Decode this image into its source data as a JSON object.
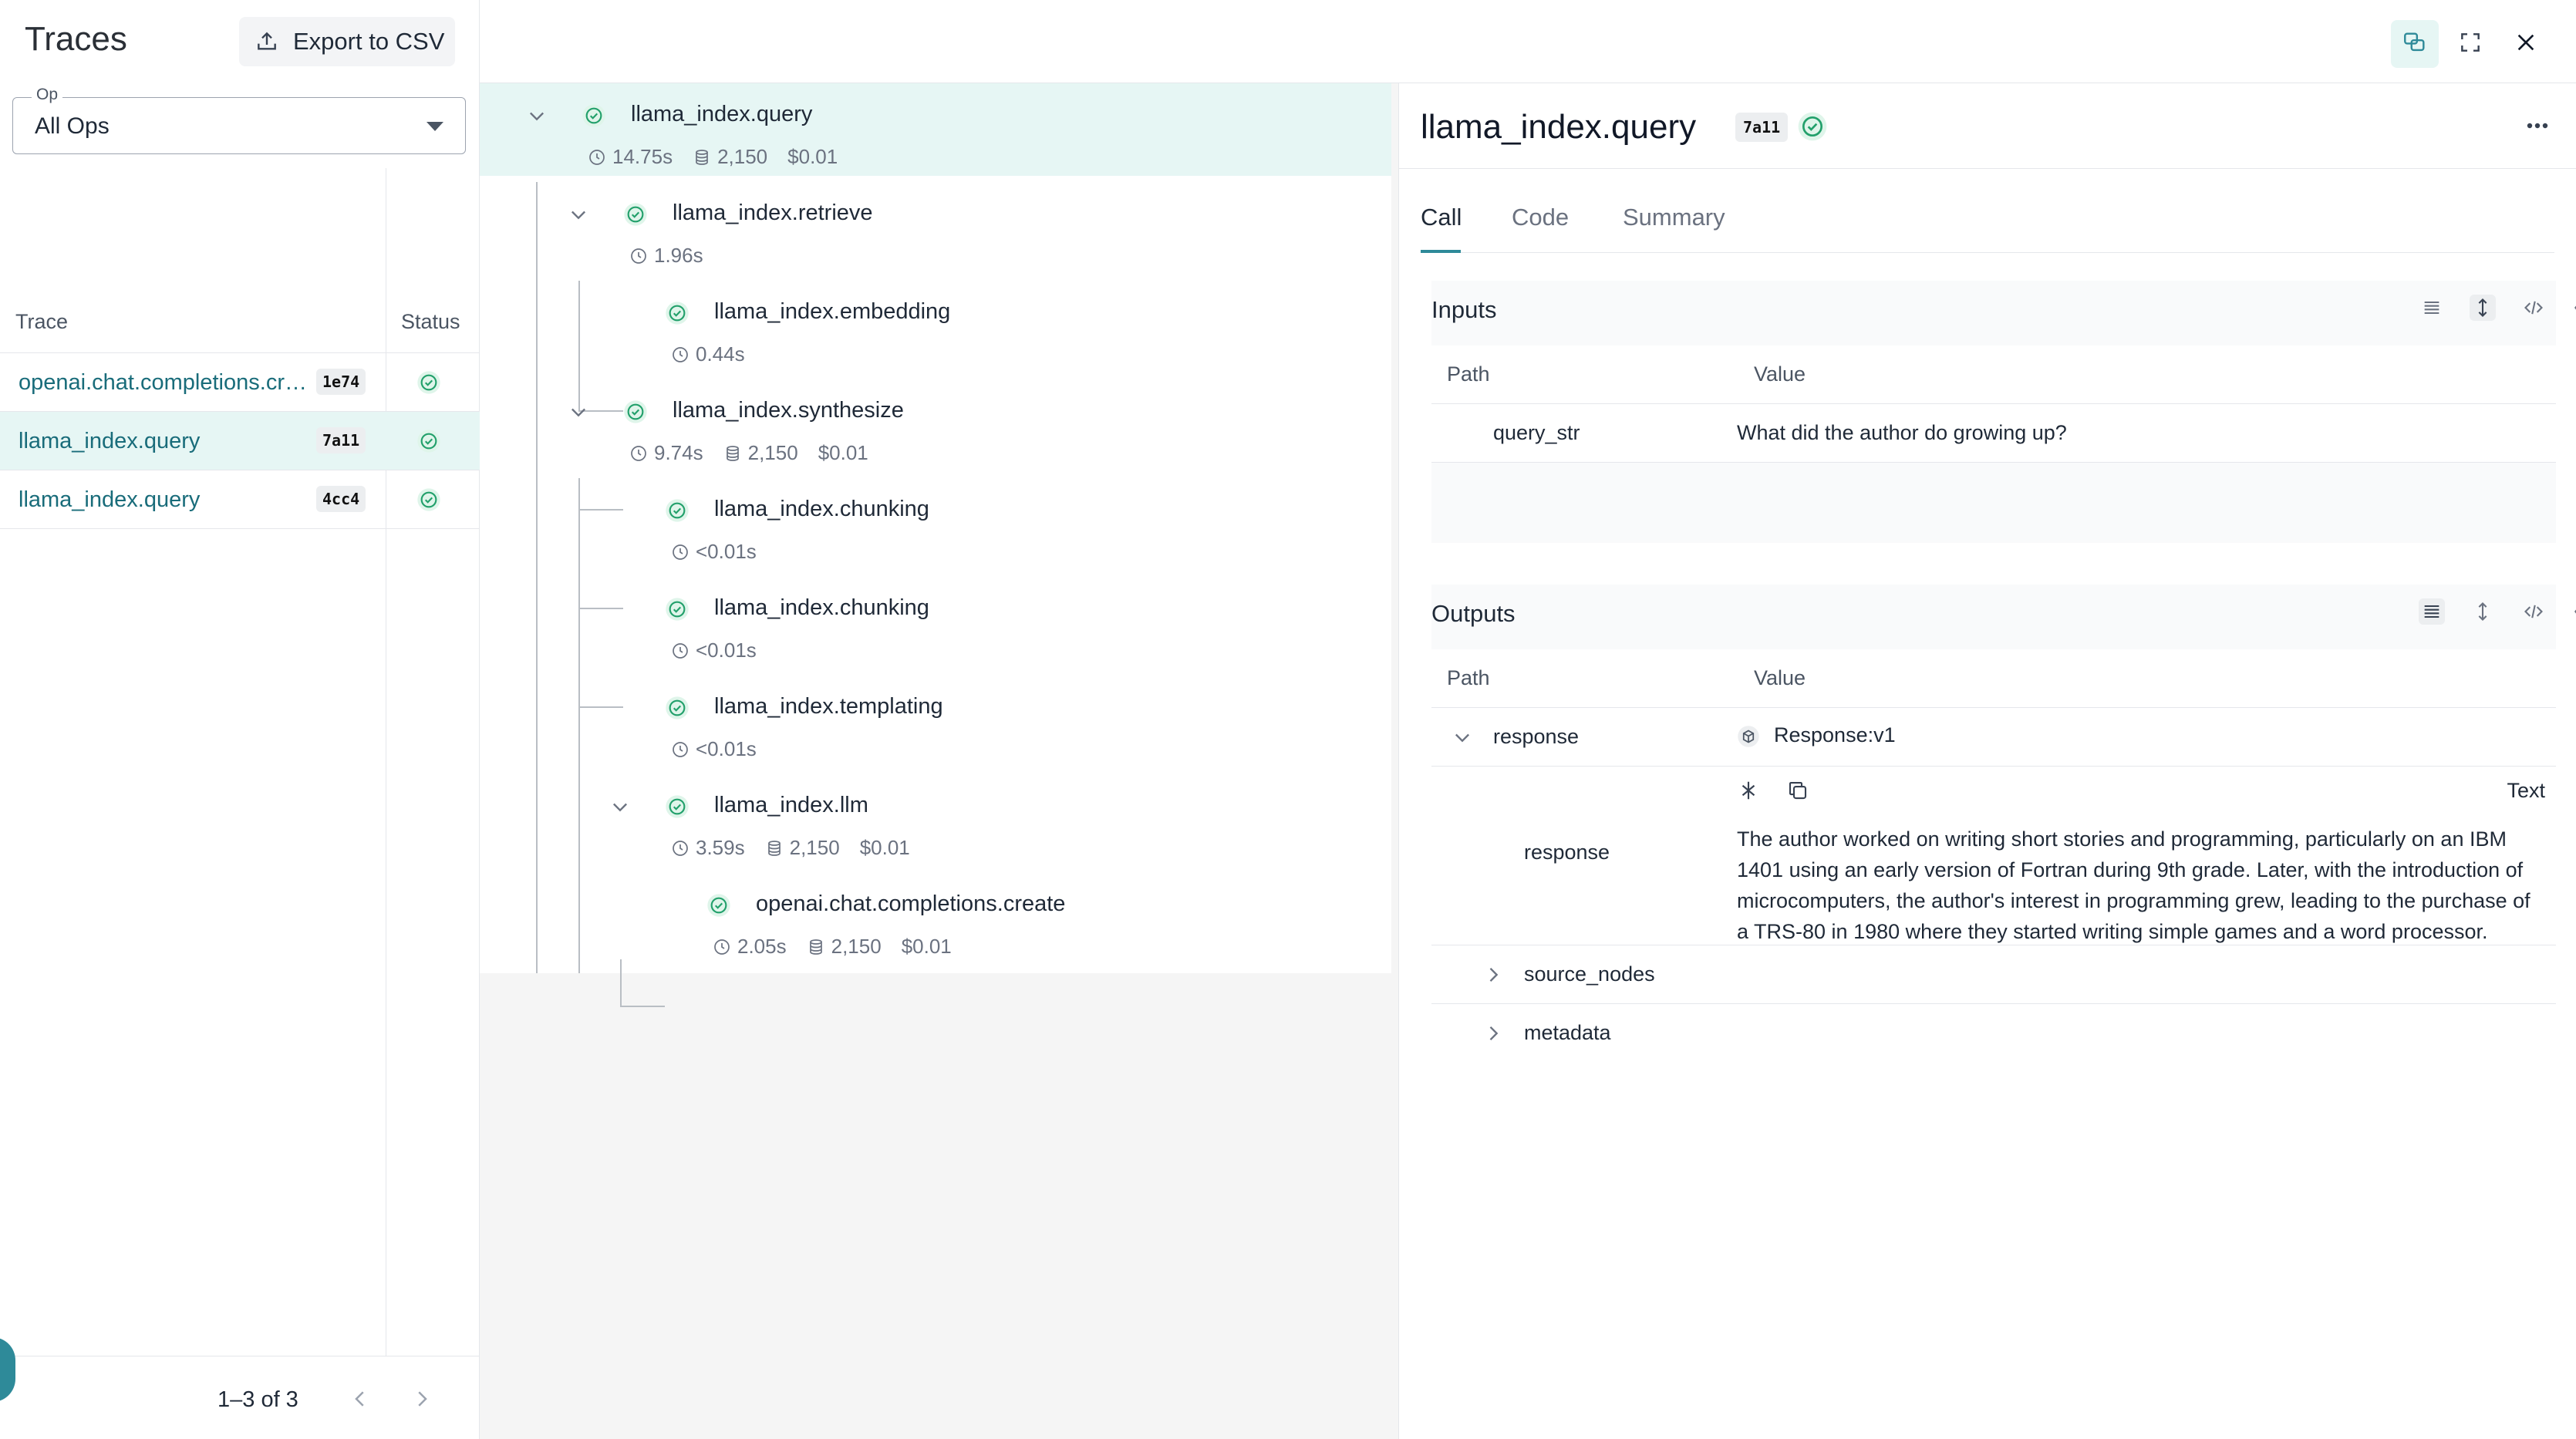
{
  "left_panel": {
    "title": "Traces",
    "export_label": "Export to CSV",
    "op_filter": {
      "label": "Op",
      "value": "All Ops"
    },
    "columns": {
      "trace": "Trace",
      "status": "Status"
    },
    "rows": [
      {
        "name": "openai.chat.completions.create",
        "id": "1e74",
        "status": "success"
      },
      {
        "name": "llama_index.query",
        "id": "7a11",
        "status": "success"
      },
      {
        "name": "llama_index.query",
        "id": "4cc4",
        "status": "success"
      }
    ],
    "pager": {
      "text": "1–3 of 3"
    }
  },
  "tree": {
    "nodes": [
      {
        "name": "llama_index.query",
        "time": "14.75s",
        "tokens": "2,150",
        "cost": "$0.01"
      },
      {
        "name": "llama_index.retrieve",
        "time": "1.96s"
      },
      {
        "name": "llama_index.embedding",
        "time": "0.44s"
      },
      {
        "name": "llama_index.synthesize",
        "time": "9.74s",
        "tokens": "2,150",
        "cost": "$0.01"
      },
      {
        "name": "llama_index.chunking",
        "time": "<0.01s"
      },
      {
        "name": "llama_index.chunking",
        "time": "<0.01s"
      },
      {
        "name": "llama_index.templating",
        "time": "<0.01s"
      },
      {
        "name": "llama_index.llm",
        "time": "3.59s",
        "tokens": "2,150",
        "cost": "$0.01"
      },
      {
        "name": "openai.chat.completions.create",
        "time": "2.05s",
        "tokens": "2,150",
        "cost": "$0.01"
      }
    ]
  },
  "details": {
    "title": "llama_index.query",
    "id": "7a11",
    "tabs": [
      "Call",
      "Code",
      "Summary"
    ],
    "inputs": {
      "title": "Inputs",
      "path_header": "Path",
      "value_header": "Value",
      "rows": [
        {
          "path": "query_str",
          "value": "What did the author do growing up?"
        }
      ]
    },
    "outputs": {
      "title": "Outputs",
      "path_header": "Path",
      "value_header": "Value",
      "response_key": "response",
      "response_value": "Response:v1",
      "text_toggle": "Text",
      "response_text_key": "response",
      "response_text": "The author worked on writing short stories and programming, particularly on an IBM 1401 using an early version of Fortran during 9th grade. Later, with the introduction of microcomputers, the author's interest in programming grew, leading to the purchase of a TRS-80 in 1980 where they started writing simple games and a word processor.",
      "source_nodes_key": "source_nodes",
      "metadata_key": "metadata"
    }
  },
  "colors": {
    "accent": "#2e8a99",
    "success": "#22a06b",
    "selected_bg": "#e6f6f4",
    "link": "#196c7a"
  }
}
